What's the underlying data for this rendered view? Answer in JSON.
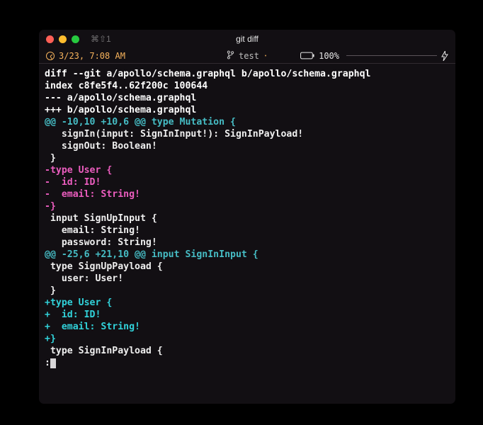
{
  "window": {
    "title": "git diff",
    "profile_indicator": "⌘⇧1"
  },
  "status": {
    "time": "3/23, 7:08 AM",
    "branch_label": "test",
    "branch_dirty_mark": "･",
    "battery_label": "100%"
  },
  "diff": {
    "lines": [
      {
        "cls": "c-bold",
        "text": "diff --git a/apollo/schema.graphql b/apollo/schema.graphql"
      },
      {
        "cls": "c-bold",
        "text": "index c8fe5f4..62f200c 100644"
      },
      {
        "cls": "c-bold",
        "text": "--- a/apollo/schema.graphql"
      },
      {
        "cls": "c-bold",
        "text": "+++ b/apollo/schema.graphql"
      },
      {
        "cls": "c-cyan",
        "text": "@@ -10,10 +10,6 @@ type Mutation {"
      },
      {
        "cls": "c-ctx",
        "text": "   signIn(input: SignInInput!): SignInPayload!"
      },
      {
        "cls": "c-ctx",
        "text": "   signOut: Boolean!"
      },
      {
        "cls": "c-ctx",
        "text": " }"
      },
      {
        "cls": "c-minus",
        "text": "-type User {"
      },
      {
        "cls": "c-minus",
        "text": "-  id: ID!"
      },
      {
        "cls": "c-minus",
        "text": "-  email: String!"
      },
      {
        "cls": "c-minus",
        "text": "-}"
      },
      {
        "cls": "c-ctx",
        "text": " input SignUpInput {"
      },
      {
        "cls": "c-ctx",
        "text": "   email: String!"
      },
      {
        "cls": "c-ctx",
        "text": "   password: String!"
      },
      {
        "cls": "c-cyan",
        "text": "@@ -25,6 +21,10 @@ input SignInInput {"
      },
      {
        "cls": "c-ctx",
        "text": " type SignUpPayload {"
      },
      {
        "cls": "c-ctx",
        "text": "   user: User!"
      },
      {
        "cls": "c-ctx",
        "text": " }"
      },
      {
        "cls": "c-plus",
        "text": "+type User {"
      },
      {
        "cls": "c-plus",
        "text": "+  id: ID!"
      },
      {
        "cls": "c-plus",
        "text": "+  email: String!"
      },
      {
        "cls": "c-plus",
        "text": "+}"
      },
      {
        "cls": "c-ctx",
        "text": " type SignInPayload {"
      }
    ],
    "pager_prompt": ":"
  }
}
